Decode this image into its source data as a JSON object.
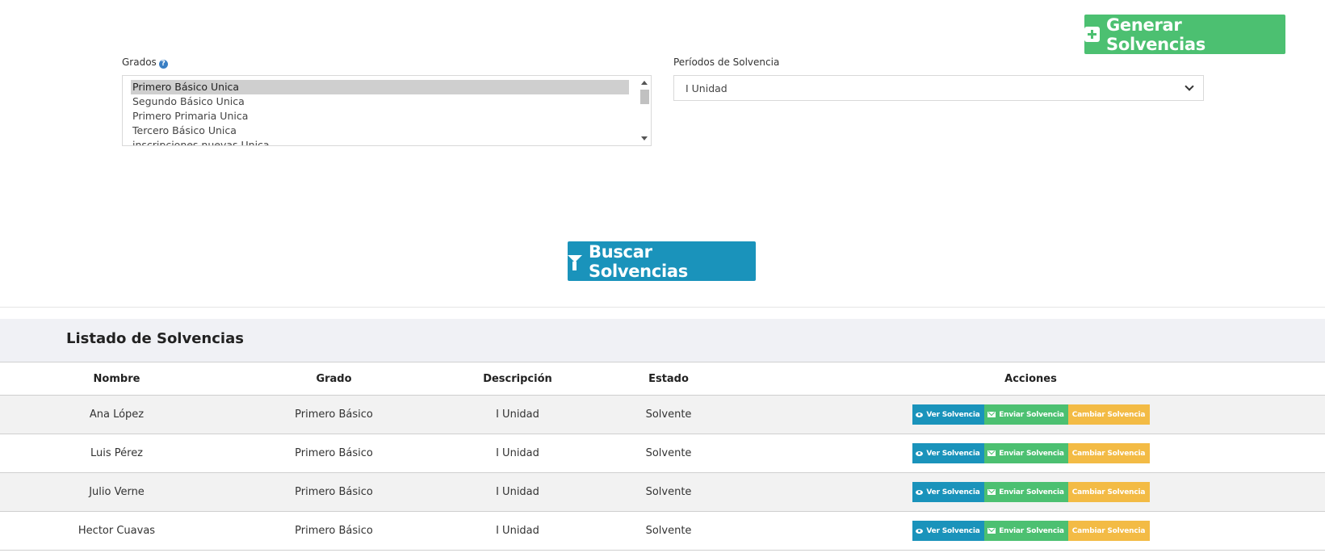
{
  "header": {
    "generar_label": "Generar Solvencias",
    "generar_icon": "plus-square-icon"
  },
  "filters": {
    "grados_label": "Grados",
    "grados_help_icon": "question-circle-icon",
    "grados_options": [
      "Primero Básico Unica",
      "Segundo Básico Unica",
      "Primero Primaria Unica",
      "Tercero Básico Unica",
      "inscripciones nuevas Unica"
    ],
    "grados_selected": "Primero Básico Unica",
    "periodos_label": "Períodos de Solvencia",
    "periodos_value": "I Unidad"
  },
  "search": {
    "buscar_label": "Buscar Solvencias",
    "buscar_icon": "filter-icon"
  },
  "listado": {
    "title": "Listado de Solvencias",
    "columns": [
      "Nombre",
      "Grado",
      "Descripción",
      "Estado",
      "Acciones"
    ],
    "rows": [
      {
        "nombre": "Ana López",
        "grado": "Primero Básico",
        "descripcion": "I Unidad",
        "estado": "Solvente"
      },
      {
        "nombre": "Luis Pérez",
        "grado": "Primero Básico",
        "descripcion": "I Unidad",
        "estado": "Solvente"
      },
      {
        "nombre": "Julio Verne",
        "grado": "Primero Básico",
        "descripcion": "I Unidad",
        "estado": "Solvente"
      },
      {
        "nombre": "Hector Cuavas",
        "grado": "Primero Básico",
        "descripcion": "I Unidad",
        "estado": "Solvente"
      }
    ],
    "actions": {
      "ver": "Ver Solvencia",
      "enviar": "Enviar Solvencia",
      "cambiar": "Cambiar Solvencia"
    }
  },
  "colors": {
    "green": "#4cc071",
    "blue": "#1a93bb",
    "orange": "#f3bb45",
    "panel_bg": "#f0f1f5"
  }
}
